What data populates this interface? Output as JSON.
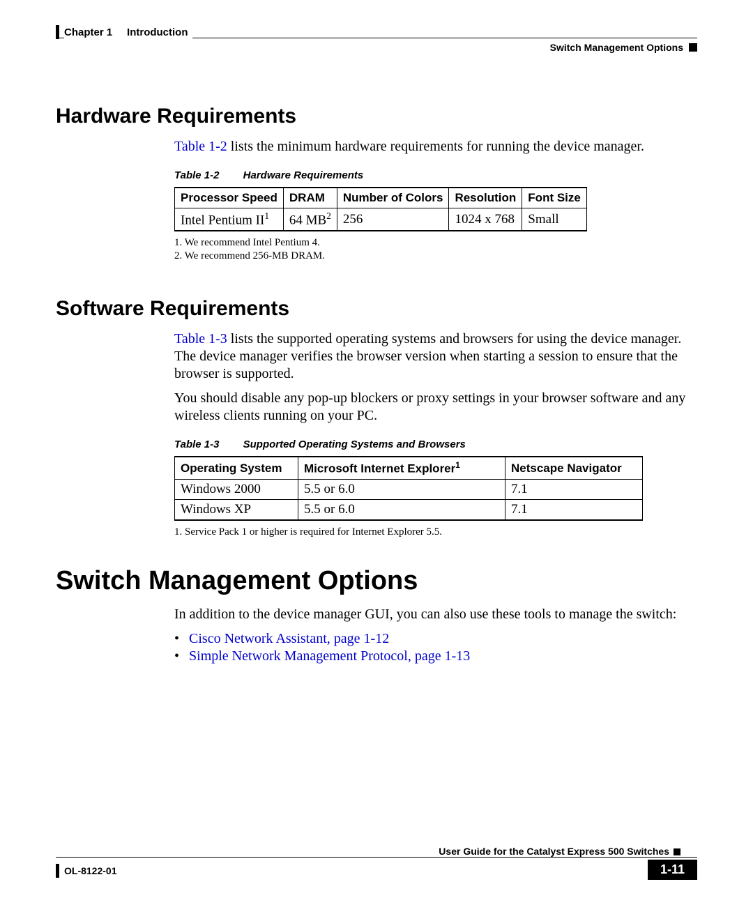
{
  "header": {
    "chapter_label": "Chapter 1",
    "chapter_title": "Introduction",
    "section": "Switch Management Options"
  },
  "hw": {
    "heading": "Hardware Requirements",
    "intro_link": "Table 1-2",
    "intro_rest": " lists the minimum hardware requirements for running the device manager.",
    "caption_label": "Table 1-2",
    "caption_title": "Hardware Requirements",
    "cols": {
      "c1": "Processor Speed",
      "c2": "DRAM",
      "c3": "Number of Colors",
      "c4": "Resolution",
      "c5": "Font Size"
    },
    "row": {
      "c1": "Intel Pentium II",
      "c1_sup": "1",
      "c2": "64 MB",
      "c2_sup": "2",
      "c3": "256",
      "c4": "1024 x 768",
      "c5": "Small"
    },
    "fn1": "1.  We recommend Intel Pentium 4.",
    "fn2": "2.  We recommend 256-MB DRAM."
  },
  "sw": {
    "heading": "Software Requirements",
    "p1_link": "Table 1-3",
    "p1_rest": " lists the supported operating systems and browsers for using the device manager. The device manager verifies the browser version when starting a session to ensure that the browser is supported.",
    "p2": "You should disable any pop-up blockers or proxy settings in your browser software and any wireless clients running on your PC.",
    "caption_label": "Table 1-3",
    "caption_title": "Supported Operating Systems and Browsers",
    "cols": {
      "c1": "Operating System",
      "c2": "Microsoft Internet Explorer",
      "c2_sup": "1",
      "c3": "Netscape Navigator"
    },
    "rows": [
      {
        "c1": "Windows 2000",
        "c2": "5.5 or 6.0",
        "c3": "7.1"
      },
      {
        "c1": "Windows XP",
        "c2": "5.5 or 6.0",
        "c3": "7.1"
      }
    ],
    "fn1": "1.  Service Pack 1 or higher is required for Internet Explorer 5.5."
  },
  "smo": {
    "heading": "Switch Management Options",
    "intro": "In addition to the device manager GUI, you can also use these tools to manage the switch:",
    "links": [
      "Cisco Network Assistant, page 1-12",
      "Simple Network Management Protocol, page 1-13"
    ]
  },
  "footer": {
    "guide": "User Guide for the Catalyst Express 500 Switches",
    "doc": "OL-8122-01",
    "page": "1-11"
  }
}
